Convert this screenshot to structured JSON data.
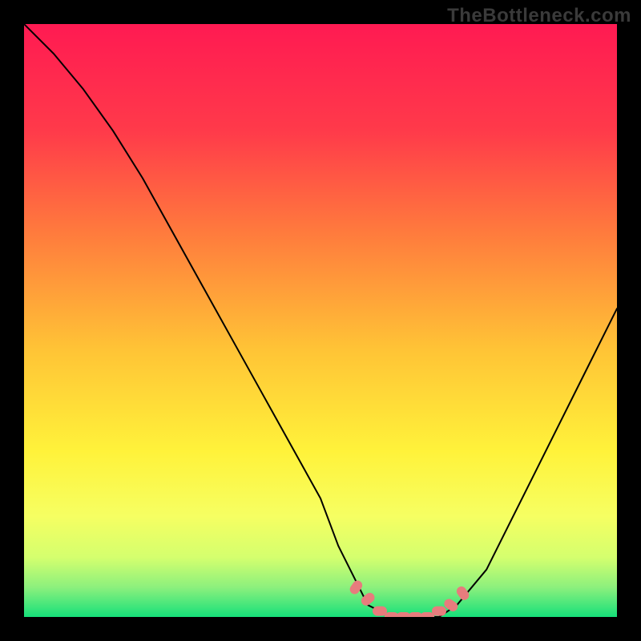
{
  "watermark": {
    "text": "TheBottleneck.com"
  },
  "chart_data": {
    "type": "line",
    "title": "",
    "xlabel": "",
    "ylabel": "",
    "xlim": [
      0,
      100
    ],
    "ylim": [
      0,
      100
    ],
    "grid": false,
    "legend": null,
    "background_gradient": {
      "top": "#ff1a52",
      "mid_upper": "#ff7a3d",
      "mid": "#ffd634",
      "mid_lower": "#f6ff62",
      "near_bottom": "#b8ff77",
      "bottom": "#16e07a"
    },
    "series": [
      {
        "name": "bottleneck-curve",
        "color": "#000000",
        "x": [
          0,
          5,
          10,
          15,
          20,
          25,
          30,
          35,
          40,
          45,
          50,
          53,
          56,
          58,
          62,
          66,
          70,
          73,
          78,
          82,
          86,
          90,
          94,
          100
        ],
        "y": [
          100,
          95,
          89,
          82,
          74,
          65,
          56,
          47,
          38,
          29,
          20,
          12,
          6,
          2,
          0,
          0,
          0,
          2,
          8,
          16,
          24,
          32,
          40,
          52
        ]
      }
    ],
    "markers": {
      "name": "trough-markers",
      "color": "#e77c7d",
      "points": [
        {
          "x": 56,
          "y": 5
        },
        {
          "x": 58,
          "y": 3
        },
        {
          "x": 60,
          "y": 1
        },
        {
          "x": 62,
          "y": 0
        },
        {
          "x": 64,
          "y": 0
        },
        {
          "x": 66,
          "y": 0
        },
        {
          "x": 68,
          "y": 0
        },
        {
          "x": 70,
          "y": 1
        },
        {
          "x": 72,
          "y": 2
        },
        {
          "x": 74,
          "y": 4
        }
      ]
    }
  }
}
